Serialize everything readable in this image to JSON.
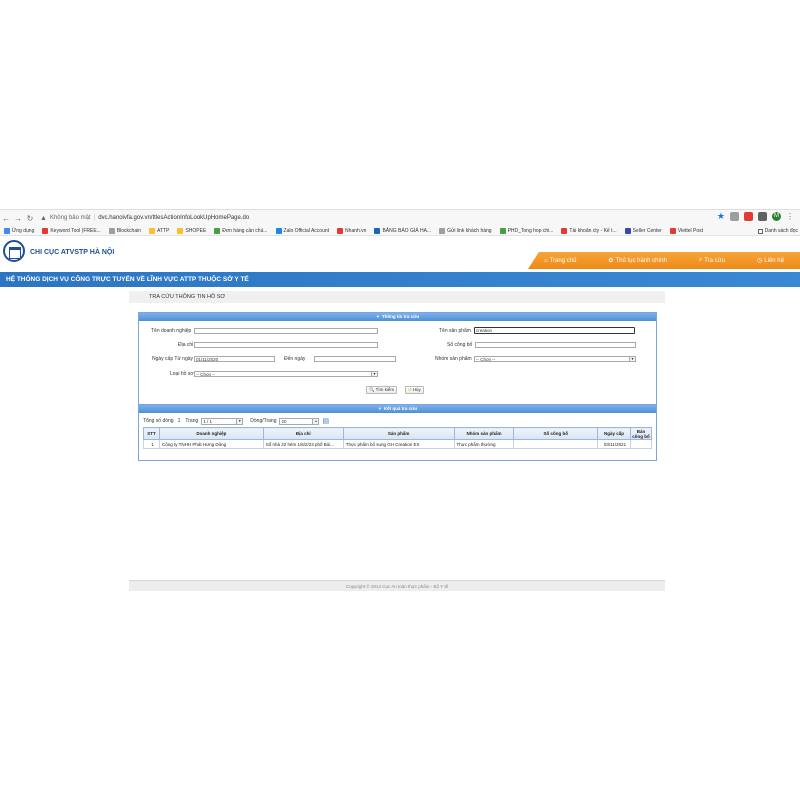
{
  "browser": {
    "security_text": "Không bảo mật",
    "url": "dvc.hanoivfa.gov.vn/ttlesActionInfoLookUpHomePage.do",
    "profile_initial": "M",
    "bookmarks": [
      {
        "label": "Ứng dụng",
        "color": "#4285f4"
      },
      {
        "label": "Keyword Tool (FREE...",
        "color": "#e53935"
      },
      {
        "label": "Blockchain",
        "color": "#9e9e9e"
      },
      {
        "label": "ATTP",
        "color": "#fbc02d"
      },
      {
        "label": "SHOPEE",
        "color": "#fbc02d"
      },
      {
        "label": "Đơn hàng cần chú...",
        "color": "#43a047"
      },
      {
        "label": "Zalo Official Account",
        "color": "#1e88e5"
      },
      {
        "label": "Nhanh.vn",
        "color": "#e53935"
      },
      {
        "label": "BẢNG BÁO GIÁ HA...",
        "color": "#1565c0"
      },
      {
        "label": "Gửi link khách hàng",
        "color": "#9e9e9e"
      },
      {
        "label": "PHD_Tong hop chi...",
        "color": "#43a047"
      },
      {
        "label": "Tài khoản cty - Kế t...",
        "color": "#e53935"
      },
      {
        "label": "Seller Center",
        "color": "#3949ab"
      },
      {
        "label": "Viettel Post",
        "color": "#e53935"
      }
    ],
    "reading_list": "Danh sách đọc"
  },
  "site": {
    "org_name": "CHI CỤC ATVSTP HÀ NỘI",
    "nav": [
      {
        "label": "Trang chủ",
        "icon": "home-icon"
      },
      {
        "label": "Thủ tục hành chính",
        "icon": "gear-icon"
      },
      {
        "label": "Tra cứu",
        "icon": "search-icon"
      },
      {
        "label": "Liên hệ",
        "icon": "clock-icon"
      }
    ],
    "banner": "HỆ THỐNG DỊCH VỤ CÔNG TRỰC TUYẾN VỀ LĨNH VỰC ATTP THUỘC SỞ Y TẾ"
  },
  "page": {
    "title": "TRA CỨU THÔNG TIN HỒ SƠ",
    "search_panel_title": "Thông tin tra cứu",
    "results_panel_title": "Kết quả tra cứu",
    "form": {
      "company_label": "Tên doanh nghiệp",
      "company_value": "",
      "product_label": "Tên sản phẩm",
      "product_value": "creation",
      "address_label": "Địa chỉ",
      "address_value": "",
      "announce_no_label": "Số công bố",
      "announce_no_value": "",
      "issue_from_label": "Ngày cấp Từ ngày",
      "issue_from_value": "01/11/2020",
      "to_date_label": "Đến ngày",
      "to_date_value": "",
      "group_label": "Nhóm sản phẩm",
      "group_value": "-- Chọn --",
      "type_label": "Loại hồ sơ",
      "type_value": "-- Chọn --",
      "search_button": "Tìm kiếm",
      "cancel_button": "Hủy"
    },
    "pager": {
      "total_label": "Tổng số dòng",
      "total_value": "1",
      "page_label": "Trang",
      "page_value": "1 / 1",
      "rows_label": "Dòng/Trang",
      "rows_value": "20"
    },
    "table": {
      "headers": [
        "STT",
        "Doanh nghiệp",
        "Địa chỉ",
        "Sản phẩm",
        "Nhóm sản phẩm",
        "Số công bố",
        "Ngày cấp",
        "Bản công bố"
      ],
      "rows": [
        [
          "1",
          "Công ty TNHH Phát Hưng Dũng",
          "Số nhà 22 hẻm 1/6/2/23 phố Bùi...",
          "Thực phẩm bổ sung GH Creation EX",
          "Thực phẩm thường",
          "",
          "03/11/2021",
          ""
        ]
      ]
    }
  },
  "footer": {
    "text": "Copyright © 2014 Cục An toàn thực phẩm - Bộ Y tế"
  }
}
